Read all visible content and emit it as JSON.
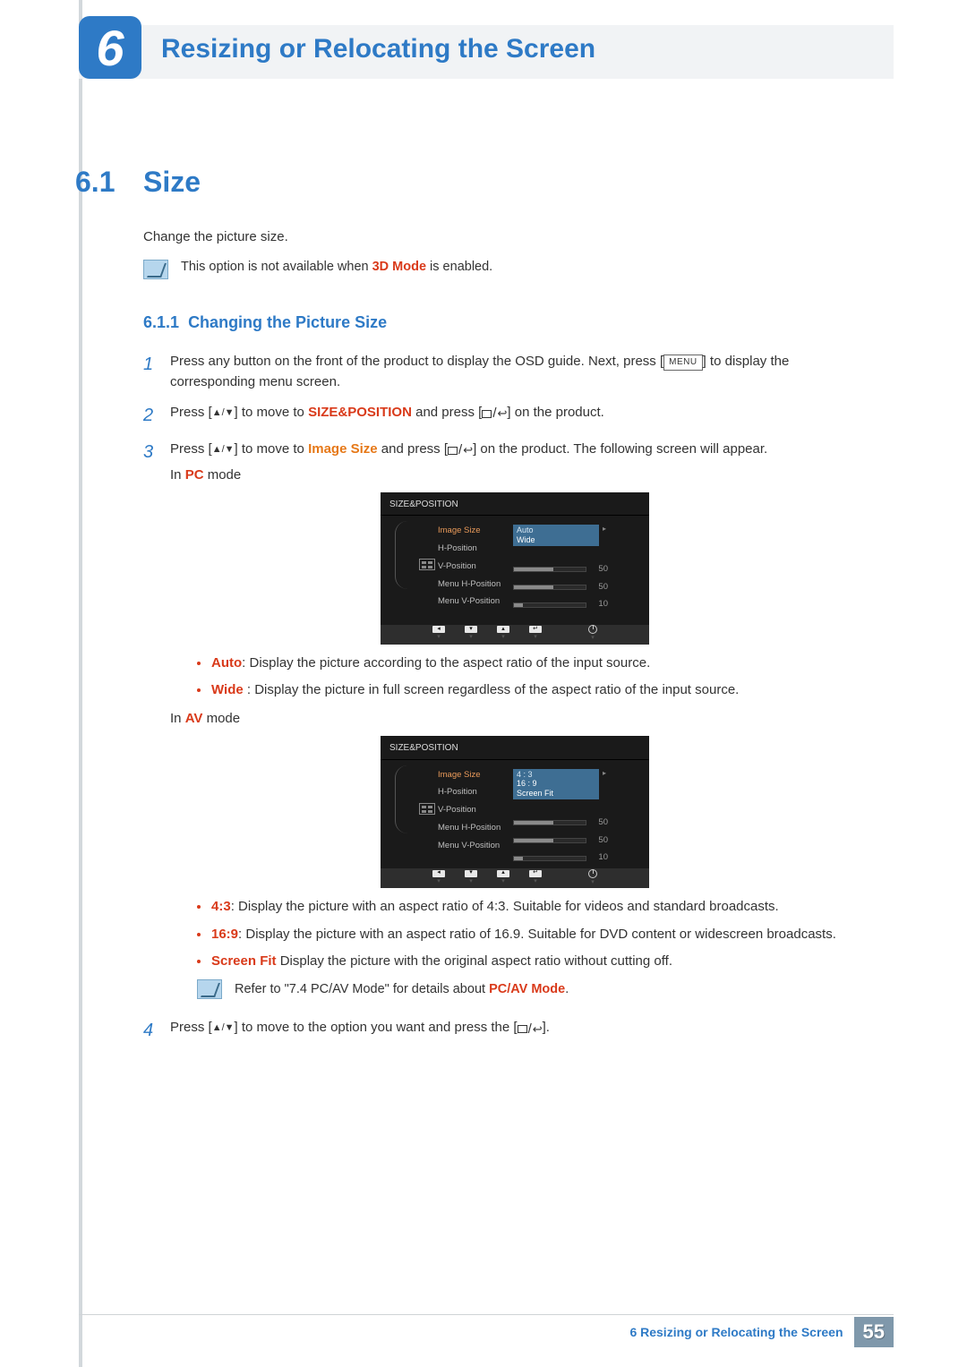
{
  "chapter": {
    "number": "6",
    "title": "Resizing or Relocating the Screen"
  },
  "section": {
    "number": "6.1",
    "title": "Size",
    "intro": "Change the picture size."
  },
  "note1": {
    "prefix": "This option is not available when ",
    "bold": "3D Mode",
    "suffix": " is enabled."
  },
  "subsection": {
    "number": "6.1.1",
    "title": "Changing the Picture Size"
  },
  "step1": {
    "num": "1",
    "a": "Press any button on the front of the product to display the OSD guide. Next, press [",
    "menu": "MENU",
    "b": "] to display the corresponding menu screen."
  },
  "step2": {
    "num": "2",
    "a": "Press [",
    "b": "] to move to ",
    "target": "SIZE&POSITION",
    "c": " and press [",
    "d": "] on the product."
  },
  "step3": {
    "num": "3",
    "a": "Press [",
    "b": "] to move to ",
    "target": "Image Size",
    "c": " and press [",
    "d": "] on the product. The following screen will appear.",
    "pc_label_a": "In ",
    "pc_label_b": "PC",
    "pc_label_c": " mode",
    "av_label_a": "In ",
    "av_label_b": "AV",
    "av_label_c": " mode"
  },
  "osd": {
    "title": "SIZE&POSITION",
    "labels": [
      "Image Size",
      "H-Position",
      "V-Position",
      "Menu H-Position",
      "Menu V-Position"
    ],
    "sliders": [
      {
        "fill": 55,
        "val": "50"
      },
      {
        "fill": 55,
        "val": "50"
      },
      {
        "fill": 12,
        "val": "10"
      }
    ],
    "pc_options": [
      "Auto",
      "Wide"
    ],
    "av_options": [
      "4 : 3",
      "16 : 9",
      "Screen Fit"
    ]
  },
  "bullets_pc": [
    {
      "term": "Auto",
      "desc": ": Display the picture according to the aspect ratio of the input source."
    },
    {
      "term": "Wide ",
      "desc": ": Display the picture in full screen regardless of the aspect ratio of the input source."
    }
  ],
  "bullets_av": [
    {
      "term": "4:3",
      "desc": ": Display the picture with an aspect ratio of 4:3. Suitable for videos and standard broadcasts."
    },
    {
      "term": "16:9",
      "desc": ": Display the picture with an aspect ratio of 16.9. Suitable for DVD content or widescreen broadcasts."
    },
    {
      "term": "Screen Fit",
      "desc": " Display the picture with the original aspect ratio without cutting off."
    }
  ],
  "note2": {
    "prefix": "Refer to \"7.4 PC/AV Mode\" for details about ",
    "bold": "PC/AV Mode",
    "suffix": "."
  },
  "step4": {
    "num": "4",
    "a": "Press [",
    "b": "] to move to the option you want and press the [",
    "c": "]."
  },
  "footer": {
    "text": "6 Resizing or Relocating the Screen",
    "page": "55"
  }
}
